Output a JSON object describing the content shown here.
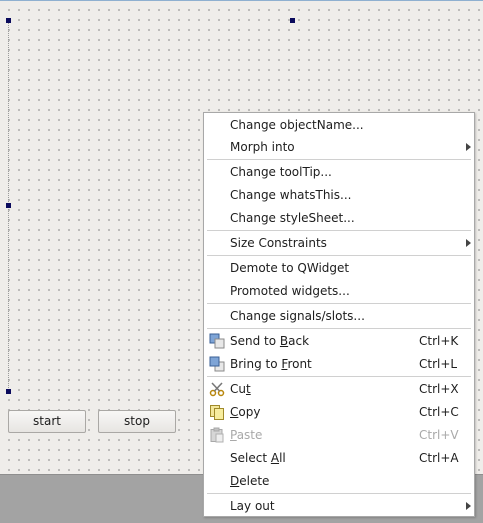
{
  "form": {
    "start_label": "start",
    "stop_label": "stop"
  },
  "context_menu": {
    "change_object_name": "Change objectName...",
    "morph_into": "Morph into",
    "change_tooltip": "Change toolTip...",
    "change_whats_this": "Change whatsThis...",
    "change_stylesheet": "Change styleSheet...",
    "size_constraints": "Size Constraints",
    "demote": "Demote to QWidget",
    "promoted_widgets": "Promoted widgets...",
    "change_signals_slots": "Change signals/slots...",
    "send_to_back": {
      "pre": "Send to ",
      "key": "B",
      "post": "ack",
      "shortcut": "Ctrl+K"
    },
    "bring_to_front": {
      "pre": "Bring to ",
      "key": "F",
      "post": "ront",
      "shortcut": "Ctrl+L"
    },
    "cut": {
      "pre": "Cu",
      "key": "t",
      "post": "",
      "shortcut": "Ctrl+X"
    },
    "copy": {
      "pre": "",
      "key": "C",
      "post": "opy",
      "shortcut": "Ctrl+C"
    },
    "paste": {
      "pre": "",
      "key": "P",
      "post": "aste",
      "shortcut": "Ctrl+V"
    },
    "select_all": {
      "pre": "Select ",
      "key": "A",
      "post": "ll",
      "shortcut": "Ctrl+A"
    },
    "delete": {
      "pre": "",
      "key": "D",
      "post": "elete"
    },
    "lay_out": "Lay out"
  }
}
